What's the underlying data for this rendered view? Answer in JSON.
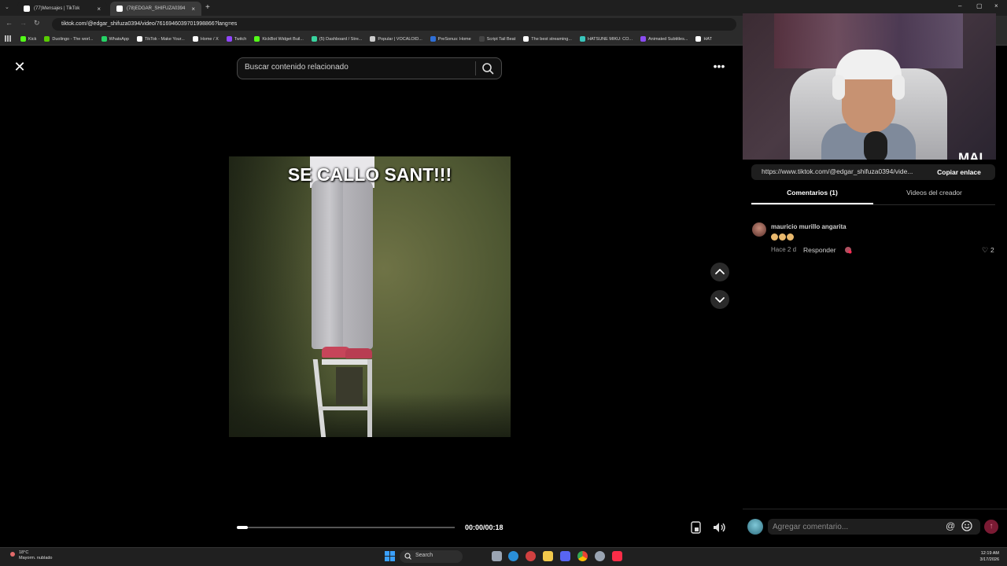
{
  "browser": {
    "tabs": [
      {
        "label": "(77)Mensajes | TikTok",
        "active": false
      },
      {
        "label": "(78)EDGAR_SHIFUZA0394",
        "active": true
      }
    ],
    "url": "tiktok.com/@edgar_shifuza0394/video/7616946039701998866?lang=es",
    "bookmarks": [
      {
        "label": "Kick",
        "color": "#53fc18"
      },
      {
        "label": "Duolingo - The worl...",
        "color": "#58cc02"
      },
      {
        "label": "WhatsApp",
        "color": "#25d366"
      },
      {
        "label": "TikTok - Make Your...",
        "color": "#ffffff"
      },
      {
        "label": "Home / X",
        "color": "#ffffff"
      },
      {
        "label": "Twitch",
        "color": "#9146ff"
      },
      {
        "label": "KickBot Widget Buil...",
        "color": "#53fc18"
      },
      {
        "label": "(5) Dashboard / Stre...",
        "color": "#38d39f"
      },
      {
        "label": "Popular | VOCALOID...",
        "color": "#cccccc"
      },
      {
        "label": "PreSonus: Home",
        "color": "#2f6fd6"
      },
      {
        "label": "Script Tail Beat",
        "color": "#444444"
      },
      {
        "label": "The best streaming...",
        "color": "#ffffff"
      },
      {
        "label": "HATSUNE MIKU: CO...",
        "color": "#39c5bb"
      },
      {
        "label": "Animated Subtitles...",
        "color": "#8a4cf0"
      },
      {
        "label": "HAT",
        "color": "#ffffff"
      }
    ]
  },
  "player": {
    "search_placeholder": "Buscar contenido relacionado",
    "overlay_caption": "SE CALLO SANT!!!",
    "time": "00:00/00:18",
    "progress": 0.05
  },
  "side": {
    "webcam_logo": "MAI",
    "link": "https://www.tiktok.com/@edgar_shifuza0394/vide...",
    "copy_label": "Copiar enlace",
    "tabs": {
      "comments": "Comentarios (1)",
      "creator_videos": "Videos del creador"
    },
    "comment": {
      "user": "mauricio murillo angarita",
      "time": "Hace 2 d",
      "reply": "Responder",
      "likes": "2"
    },
    "input_placeholder": "Agregar comentario...",
    "mention": "@"
  },
  "taskbar": {
    "temp": "18°C",
    "weather": "Mayorm. nublado",
    "search": "Search",
    "time": "12:19 AM",
    "date": "3/17/2026"
  },
  "colors": {
    "send_button": "#7a1a33",
    "background": "#000000"
  }
}
